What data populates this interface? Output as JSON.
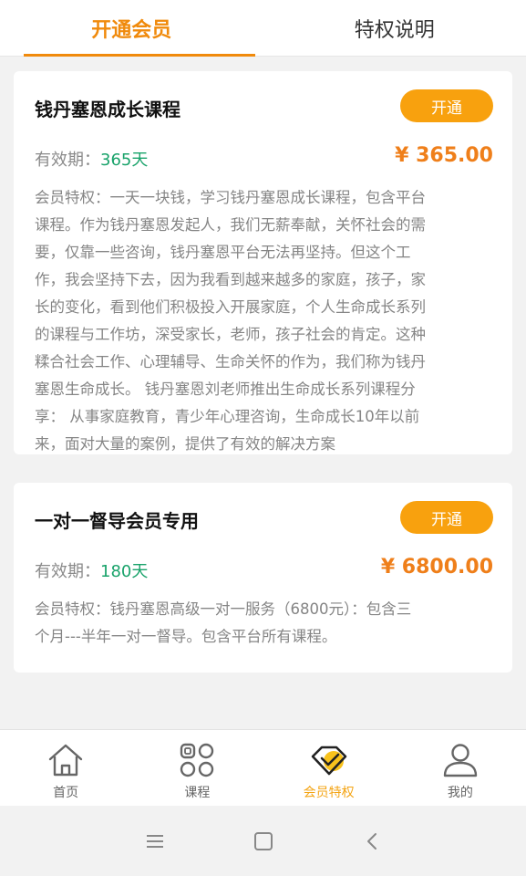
{
  "tabs": [
    {
      "label": "开通会员",
      "active": true
    },
    {
      "label": "特权说明",
      "active": false
    }
  ],
  "plans": [
    {
      "title": "钱丹塞恩成长课程",
      "button": "开通",
      "validity_label": "有效期：",
      "validity_days": "365天",
      "price": "¥ 365.00",
      "desc_lines": [
        "会员特权：一天一块钱，学习钱丹塞恩成长课程，包含平台",
        "课程。作为钱丹塞恩发起人，我们无薪奉献，关怀社会的需",
        "要，仅靠一些咨询，钱丹塞恩平台无法再坚持。但这个工",
        "作，我会坚持下去，因为我看到越来越多的家庭，孩子，家",
        "长的变化，看到他们积极投入开展家庭，个人生命成长系列",
        "的课程与工作坊，深受家长，老师，孩子社会的肯定。这种",
        "糅合社会工作、心理辅导、生命关怀的作为，我们称为钱丹",
        "塞恩生命成长。 钱丹塞恩刘老师推出生命成长系列课程分",
        "享： 从事家庭教育，青少年心理咨询，生命成长10年以前",
        "来，面对大量的案例，提供了有效的解决方案"
      ]
    },
    {
      "title": "一对一督导会员专用",
      "button": "开通",
      "validity_label": "有效期：",
      "validity_days": "180天",
      "price": "¥ 6800.00",
      "desc_lines": [
        "会员特权：钱丹塞恩高级一对一服务（6800元）：包含三",
        "个月---半年一对一督导。包含平台所有课程。"
      ]
    }
  ],
  "bottom_nav": [
    {
      "label": "首页",
      "icon": "home-icon",
      "active": false
    },
    {
      "label": "课程",
      "icon": "grid-icon",
      "active": false
    },
    {
      "label": "会员特权",
      "icon": "vip-diamond-icon",
      "active": true
    },
    {
      "label": "我的",
      "icon": "user-icon",
      "active": false
    }
  ],
  "system_nav": [
    "menu-icon",
    "home-square-icon",
    "back-icon"
  ],
  "colors": {
    "accent": "#f08a0c",
    "button": "#f8a10e",
    "price": "#ef7f1a",
    "days": "#1aa36b",
    "nav_active": "#f4a414"
  }
}
